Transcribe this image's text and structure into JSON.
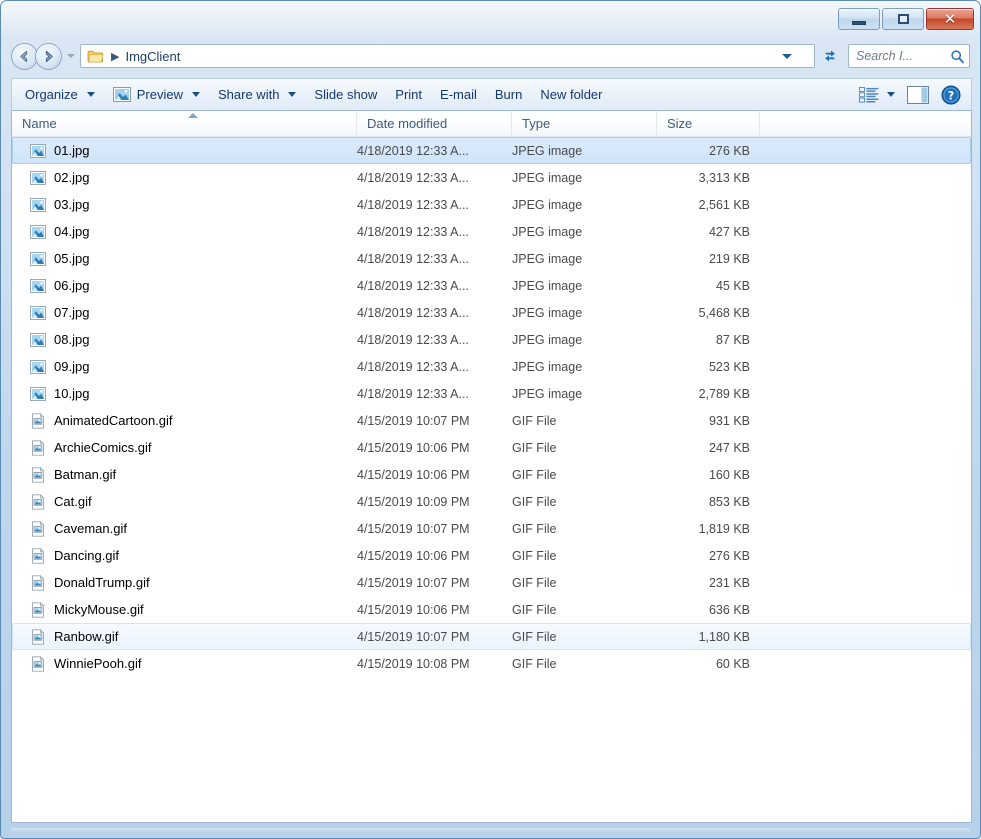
{
  "window": {
    "title": "",
    "controls": {
      "minimize_label": "Minimize",
      "maximize_label": "Maximize",
      "close_label": "✕"
    }
  },
  "address_bar": {
    "back_label": "Back",
    "forward_label": "Forward",
    "recent_pages_label": "Recent pages",
    "folder_icon": "folder-icon",
    "separator": "▶",
    "path_text": "ImgClient",
    "dropdown_label": "Previous locations",
    "refresh_label": "Refresh",
    "search_placeholder": "Search I...",
    "search_value": "",
    "search_icon": "search-icon"
  },
  "toolbar": {
    "items": [
      {
        "label": "Organize",
        "icon": "",
        "caret": true
      },
      {
        "label": "Preview",
        "icon": "preview-image-icon",
        "caret": true
      },
      {
        "label": "Share with",
        "icon": "",
        "caret": true
      },
      {
        "label": "Slide show",
        "icon": "",
        "caret": false
      },
      {
        "label": "Print",
        "icon": "",
        "caret": false
      },
      {
        "label": "E-mail",
        "icon": "",
        "caret": false
      },
      {
        "label": "Burn",
        "icon": "",
        "caret": false
      },
      {
        "label": "New folder",
        "icon": "",
        "caret": false
      }
    ],
    "view_button_label": "Change your view",
    "view_icon": "list-view-icon",
    "preview_pane_label": "Show the preview pane",
    "preview_pane_icon": "preview-pane-icon",
    "help_label": "Get help",
    "help_icon": "help-icon"
  },
  "file_list": {
    "columns": [
      {
        "key": "name",
        "label": "Name",
        "sorted": "asc"
      },
      {
        "key": "date",
        "label": "Date modified",
        "sorted": ""
      },
      {
        "key": "type",
        "label": "Type",
        "sorted": ""
      },
      {
        "key": "size",
        "label": "Size",
        "sorted": ""
      }
    ],
    "rows": [
      {
        "name": "01.jpg",
        "date": "4/18/2019 12:33 A...",
        "type": "JPEG image",
        "size": "276 KB",
        "icon": "jpeg-image-icon",
        "state": "selected"
      },
      {
        "name": "02.jpg",
        "date": "4/18/2019 12:33 A...",
        "type": "JPEG image",
        "size": "3,313 KB",
        "icon": "jpeg-image-icon",
        "state": ""
      },
      {
        "name": "03.jpg",
        "date": "4/18/2019 12:33 A...",
        "type": "JPEG image",
        "size": "2,561 KB",
        "icon": "jpeg-image-icon",
        "state": ""
      },
      {
        "name": "04.jpg",
        "date": "4/18/2019 12:33 A...",
        "type": "JPEG image",
        "size": "427 KB",
        "icon": "jpeg-image-icon",
        "state": ""
      },
      {
        "name": "05.jpg",
        "date": "4/18/2019 12:33 A...",
        "type": "JPEG image",
        "size": "219 KB",
        "icon": "jpeg-image-icon",
        "state": ""
      },
      {
        "name": "06.jpg",
        "date": "4/18/2019 12:33 A...",
        "type": "JPEG image",
        "size": "45 KB",
        "icon": "jpeg-image-icon",
        "state": ""
      },
      {
        "name": "07.jpg",
        "date": "4/18/2019 12:33 A...",
        "type": "JPEG image",
        "size": "5,468 KB",
        "icon": "jpeg-image-icon",
        "state": ""
      },
      {
        "name": "08.jpg",
        "date": "4/18/2019 12:33 A...",
        "type": "JPEG image",
        "size": "87 KB",
        "icon": "jpeg-image-icon",
        "state": ""
      },
      {
        "name": "09.jpg",
        "date": "4/18/2019 12:33 A...",
        "type": "JPEG image",
        "size": "523 KB",
        "icon": "jpeg-image-icon",
        "state": ""
      },
      {
        "name": "10.jpg",
        "date": "4/18/2019 12:33 A...",
        "type": "JPEG image",
        "size": "2,789 KB",
        "icon": "jpeg-image-icon",
        "state": ""
      },
      {
        "name": "AnimatedCartoon.gif",
        "date": "4/15/2019 10:07 PM",
        "type": "GIF File",
        "size": "931 KB",
        "icon": "gif-file-icon",
        "state": ""
      },
      {
        "name": "ArchieComics.gif",
        "date": "4/15/2019 10:06 PM",
        "type": "GIF File",
        "size": "247 KB",
        "icon": "gif-file-icon",
        "state": ""
      },
      {
        "name": "Batman.gif",
        "date": "4/15/2019 10:06 PM",
        "type": "GIF File",
        "size": "160 KB",
        "icon": "gif-file-icon",
        "state": ""
      },
      {
        "name": "Cat.gif",
        "date": "4/15/2019 10:09 PM",
        "type": "GIF File",
        "size": "853 KB",
        "icon": "gif-file-icon",
        "state": ""
      },
      {
        "name": "Caveman.gif",
        "date": "4/15/2019 10:07 PM",
        "type": "GIF File",
        "size": "1,819 KB",
        "icon": "gif-file-icon",
        "state": ""
      },
      {
        "name": "Dancing.gif",
        "date": "4/15/2019 10:06 PM",
        "type": "GIF File",
        "size": "276 KB",
        "icon": "gif-file-icon",
        "state": ""
      },
      {
        "name": "DonaldTrump.gif",
        "date": "4/15/2019 10:07 PM",
        "type": "GIF File",
        "size": "231 KB",
        "icon": "gif-file-icon",
        "state": ""
      },
      {
        "name": "MickyMouse.gif",
        "date": "4/15/2019 10:06 PM",
        "type": "GIF File",
        "size": "636 KB",
        "icon": "gif-file-icon",
        "state": ""
      },
      {
        "name": "Ranbow.gif",
        "date": "4/15/2019 10:07 PM",
        "type": "GIF File",
        "size": "1,180 KB",
        "icon": "gif-file-icon",
        "state": "hover"
      },
      {
        "name": "WinniePooh.gif",
        "date": "4/15/2019 10:08 PM",
        "type": "GIF File",
        "size": "60 KB",
        "icon": "gif-file-icon",
        "state": ""
      }
    ]
  },
  "colors": {
    "frame": "#b8d1ea",
    "selection": "#cfe4fa",
    "selection_border": "#a8cfee",
    "hover": "#eaf4fd",
    "close_button": "#c4472a",
    "link_text": "#13386b",
    "header_text": "#41597a"
  }
}
